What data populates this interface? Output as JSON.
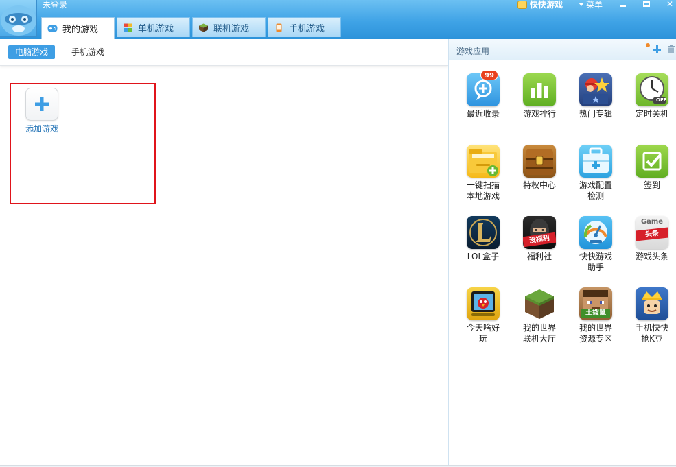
{
  "window": {
    "login_status": "未登录",
    "brand_name": "快快游戏",
    "menu_label": "菜单"
  },
  "main_tabs": [
    {
      "label": "我的游戏",
      "active": true,
      "icon": "gamepad-icon"
    },
    {
      "label": "单机游戏",
      "active": false,
      "icon": "grid-icon"
    },
    {
      "label": "联机游戏",
      "active": false,
      "icon": "cube-icon"
    },
    {
      "label": "手机游戏",
      "active": false,
      "icon": "phone-icon"
    }
  ],
  "sub_tabs": [
    {
      "label": "电脑游戏",
      "active": true
    },
    {
      "label": "手机游戏",
      "active": false
    }
  ],
  "my_games": {
    "add_label": "添加游戏"
  },
  "panel": {
    "title": "游戏应用",
    "apps": [
      {
        "label": "最近收录",
        "icon": "recent-icon",
        "badge": "99"
      },
      {
        "label": "游戏排行",
        "icon": "ranking-icon"
      },
      {
        "label": "热门专辑",
        "icon": "hot-album-icon"
      },
      {
        "label": "定时关机",
        "icon": "clock-icon",
        "icon_text": "OFF"
      },
      {
        "label": "一键扫描\n本地游戏",
        "icon": "folder-scan-icon"
      },
      {
        "label": "特权中心",
        "icon": "treasure-chest-icon"
      },
      {
        "label": "游戏配置\n检测",
        "icon": "toolbox-icon"
      },
      {
        "label": "签到",
        "icon": "checkin-icon"
      },
      {
        "label": "LOL盒子",
        "icon": "lol-icon"
      },
      {
        "label": "福利社",
        "icon": "welfare-icon",
        "icon_text": "没福利"
      },
      {
        "label": "快快游戏\n助手",
        "icon": "gauge-icon"
      },
      {
        "label": "游戏头条",
        "icon": "headline-icon",
        "icon_text": "Game",
        "icon_text2": "头条"
      },
      {
        "label": "今天啥好\n玩",
        "icon": "angry-birds-icon"
      },
      {
        "label": "我的世界\n联机大厅",
        "icon": "minecraft-block-icon"
      },
      {
        "label": "我的世界\n资源专区",
        "icon": "minecraft-character-icon",
        "icon_text": "土拨鼠"
      },
      {
        "label": "手机快快\n抢K豆",
        "icon": "king-icon"
      }
    ]
  },
  "colors": {
    "accent": "#3e9ee4",
    "titlebar": "#3fa3e6",
    "highlight_border": "#e0141b"
  }
}
